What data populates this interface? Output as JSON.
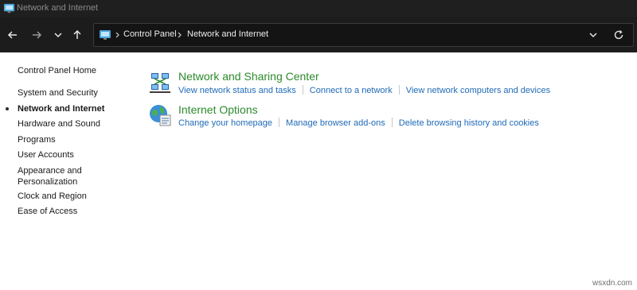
{
  "window": {
    "title": "Network and Internet"
  },
  "address_bar": {
    "breadcrumbs": [
      "Control Panel",
      "Network and Internet"
    ]
  },
  "sidebar": {
    "home": "Control Panel Home",
    "items": [
      {
        "label": "System and Security",
        "active": false
      },
      {
        "label": "Network and Internet",
        "active": true
      },
      {
        "label": "Hardware and Sound",
        "active": false
      },
      {
        "label": "Programs",
        "active": false
      },
      {
        "label": "User Accounts",
        "active": false
      },
      {
        "label": "Appearance and Personalization",
        "line1": "Appearance and",
        "line2": "Personalization",
        "active": false
      },
      {
        "label": "Clock and Region",
        "active": false
      },
      {
        "label": "Ease of Access",
        "active": false
      }
    ]
  },
  "categories": [
    {
      "title": "Network and Sharing Center",
      "icon": "network-sharing-icon",
      "tasks": [
        "View network status and tasks",
        "Connect to a network",
        "View network computers and devices"
      ]
    },
    {
      "title": "Internet Options",
      "icon": "internet-options-icon",
      "tasks": [
        "Change your homepage",
        "Manage browser add-ons",
        "Delete browsing history and cookies"
      ]
    }
  ],
  "watermark": "wsxdn.com",
  "colors": {
    "titlebar_bg": "#1f1f1f",
    "toolbar_bg": "#1c1c1c",
    "category_title": "#2c8a2c",
    "task_link": "#1f6ab7"
  }
}
